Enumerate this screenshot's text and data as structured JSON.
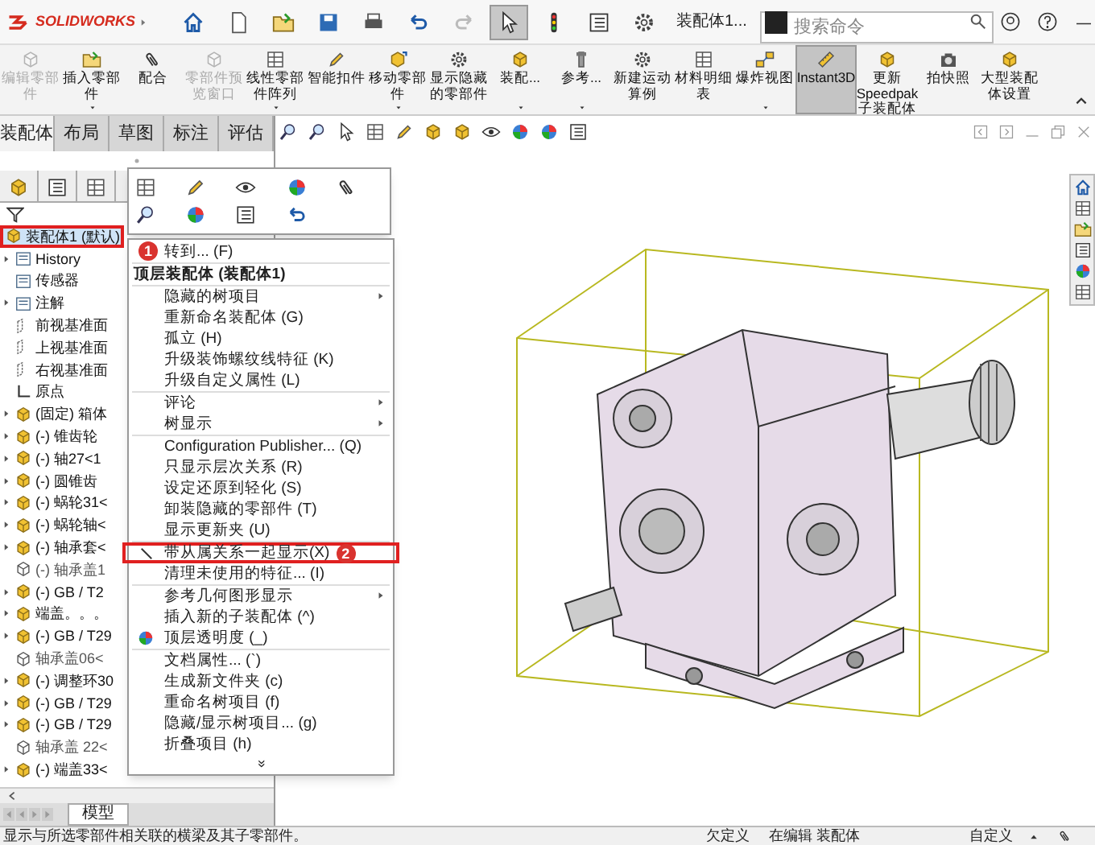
{
  "app": {
    "logo": "SOLIDWORKS",
    "title": "装配体1...",
    "search": {
      "placeholder": "搜索命令"
    }
  },
  "quick_tools": [
    {
      "selected": false
    },
    {
      "selected": false
    },
    {
      "selected": false
    },
    {
      "selected": false
    },
    {
      "selected": false
    },
    {
      "selected": false
    },
    {
      "selected": false
    },
    {
      "selected": true
    },
    {
      "selected": false
    },
    {
      "selected": false
    },
    {
      "selected": false
    }
  ],
  "ribbon": [
    {
      "label": "编辑零部件",
      "disabled": true,
      "dropdown": false,
      "selected": false
    },
    {
      "label": "插入零部件",
      "disabled": false,
      "dropdown": true,
      "selected": false
    },
    {
      "label": "配合",
      "disabled": false,
      "dropdown": false,
      "selected": false
    },
    {
      "label": "零部件预览窗口",
      "disabled": true,
      "dropdown": false,
      "selected": false
    },
    {
      "label": "线性零部件阵列",
      "disabled": false,
      "dropdown": true,
      "selected": false
    },
    {
      "label": "智能扣件",
      "disabled": false,
      "dropdown": false,
      "selected": false
    },
    {
      "label": "移动零部件",
      "disabled": false,
      "dropdown": true,
      "selected": false
    },
    {
      "label": "显示隐藏的零部件",
      "disabled": false,
      "dropdown": false,
      "selected": false
    },
    {
      "label": "装配...",
      "disabled": false,
      "dropdown": true,
      "selected": false
    },
    {
      "label": "参考...",
      "disabled": false,
      "dropdown": true,
      "selected": false
    },
    {
      "label": "新建运动算例",
      "disabled": false,
      "dropdown": false,
      "selected": false
    },
    {
      "label": "材料明细表",
      "disabled": false,
      "dropdown": false,
      "selected": false
    },
    {
      "label": "爆炸视图",
      "disabled": false,
      "dropdown": true,
      "selected": false
    },
    {
      "label": "Instant3D",
      "disabled": false,
      "dropdown": false,
      "selected": true
    },
    {
      "label": "更新 Speedpak 子装配体",
      "disabled": false,
      "dropdown": false,
      "selected": false
    },
    {
      "label": "拍快照",
      "disabled": false,
      "dropdown": false,
      "selected": false
    },
    {
      "label": "大型装配体设置",
      "disabled": false,
      "dropdown": false,
      "selected": false
    }
  ],
  "ribbon_tabs": [
    {
      "label": "装配体",
      "selected": true
    },
    {
      "label": "布局",
      "selected": false
    },
    {
      "label": "草图",
      "selected": false
    },
    {
      "label": "标注",
      "selected": false
    },
    {
      "label": "评估",
      "selected": false
    }
  ],
  "tree": [
    {
      "kind": "assembly",
      "label": "装配体1 (默认)",
      "expandable": false,
      "selected": true,
      "hidden": false
    },
    {
      "kind": "history",
      "label": "History",
      "expandable": true,
      "selected": false,
      "hidden": false
    },
    {
      "kind": "sensor",
      "label": "传感器",
      "expandable": false,
      "selected": false,
      "hidden": false
    },
    {
      "kind": "annotation",
      "label": "注解",
      "expandable": true,
      "selected": false,
      "hidden": false
    },
    {
      "kind": "plane",
      "label": "前视基准面",
      "expandable": false,
      "selected": false,
      "hidden": false
    },
    {
      "kind": "plane",
      "label": "上视基准面",
      "expandable": false,
      "selected": false,
      "hidden": false
    },
    {
      "kind": "plane",
      "label": "右视基准面",
      "expandable": false,
      "selected": false,
      "hidden": false
    },
    {
      "kind": "origin",
      "label": "原点",
      "expandable": false,
      "selected": false,
      "hidden": false
    },
    {
      "kind": "part",
      "label": "(固定) 箱体",
      "expandable": true,
      "selected": false,
      "hidden": false
    },
    {
      "kind": "part",
      "label": "(-) 锥齿轮",
      "expandable": true,
      "selected": false,
      "hidden": false
    },
    {
      "kind": "part",
      "label": "(-) 轴27<1",
      "expandable": true,
      "selected": false,
      "hidden": false
    },
    {
      "kind": "part",
      "label": "(-) 圆锥齿",
      "expandable": true,
      "selected": false,
      "hidden": false
    },
    {
      "kind": "part",
      "label": "(-) 蜗轮31<",
      "expandable": true,
      "selected": false,
      "hidden": false
    },
    {
      "kind": "part",
      "label": "(-) 蜗轮轴<",
      "expandable": true,
      "selected": false,
      "hidden": false
    },
    {
      "kind": "part",
      "label": "(-) 轴承套<",
      "expandable": true,
      "selected": false,
      "hidden": false
    },
    {
      "kind": "part",
      "label": "(-) 轴承盖1",
      "expandable": false,
      "selected": false,
      "hidden": true
    },
    {
      "kind": "part",
      "label": "(-) GB / T2",
      "expandable": true,
      "selected": false,
      "hidden": false
    },
    {
      "kind": "part",
      "label": "端盖。。。",
      "expandable": true,
      "selected": false,
      "hidden": false
    },
    {
      "kind": "part",
      "label": "(-) GB / T29",
      "expandable": true,
      "selected": false,
      "hidden": false
    },
    {
      "kind": "part",
      "label": "轴承盖06<",
      "expandable": false,
      "selected": false,
      "hidden": true
    },
    {
      "kind": "part",
      "label": "(-) 调整环30",
      "expandable": true,
      "selected": false,
      "hidden": false
    },
    {
      "kind": "part",
      "label": "(-) GB / T29",
      "expandable": true,
      "selected": false,
      "hidden": false
    },
    {
      "kind": "part",
      "label": "(-) GB / T29",
      "expandable": true,
      "selected": false,
      "hidden": false
    },
    {
      "kind": "part",
      "label": "轴承盖 22<",
      "expandable": false,
      "selected": false,
      "hidden": true
    },
    {
      "kind": "part",
      "label": "(-) 端盖33<",
      "expandable": true,
      "selected": false,
      "hidden": false
    }
  ],
  "context_menu": {
    "groups": [
      {
        "items": [
          {
            "kind": "item",
            "label": "转到... (F)",
            "submenu": false,
            "highlighted": false,
            "callout": "1"
          }
        ]
      },
      {
        "items": [
          {
            "kind": "header",
            "label": "顶层装配体 (装配体1)"
          }
        ]
      },
      {
        "items": [
          {
            "kind": "item",
            "label": "隐藏的树项目",
            "submenu": true,
            "highlighted": false
          },
          {
            "kind": "item",
            "label": "重新命名装配体 (G)",
            "submenu": false,
            "highlighted": false
          },
          {
            "kind": "item",
            "label": "孤立 (H)",
            "submenu": false,
            "highlighted": false
          },
          {
            "kind": "item",
            "label": "升级装饰螺纹线特征 (K)",
            "submenu": false,
            "highlighted": false
          },
          {
            "kind": "item",
            "label": "升级自定义属性 (L)",
            "submenu": false,
            "highlighted": false
          }
        ]
      },
      {
        "items": [
          {
            "kind": "item",
            "label": "评论",
            "submenu": true,
            "highlighted": false
          },
          {
            "kind": "item",
            "label": "树显示",
            "submenu": true,
            "highlighted": false
          }
        ]
      },
      {
        "items": [
          {
            "kind": "item",
            "label": "Configuration Publisher... (Q)",
            "submenu": false,
            "highlighted": false
          },
          {
            "kind": "item",
            "label": "只显示层次关系 (R)",
            "submenu": false,
            "highlighted": false
          },
          {
            "kind": "item",
            "label": "设定还原到轻化 (S)",
            "submenu": false,
            "highlighted": false
          },
          {
            "kind": "item",
            "label": "卸装隐藏的零部件 (T)",
            "submenu": false,
            "highlighted": false
          },
          {
            "kind": "item",
            "label": "显示更新夹 (U)",
            "submenu": false,
            "highlighted": false
          }
        ]
      },
      {
        "items": [
          {
            "kind": "item",
            "label": "带从属关系一起显示(X)",
            "submenu": false,
            "highlighted": true,
            "callout": "2"
          },
          {
            "kind": "item",
            "label": "清理未使用的特征... (I)",
            "submenu": false,
            "highlighted": false
          }
        ]
      },
      {
        "items": [
          {
            "kind": "item",
            "label": "参考几何图形显示",
            "submenu": true,
            "highlighted": false
          },
          {
            "kind": "item",
            "label": "插入新的子装配体 (^)",
            "submenu": false,
            "highlighted": false
          },
          {
            "kind": "item",
            "label": "顶层透明度 (_)",
            "submenu": false,
            "highlighted": false
          }
        ]
      },
      {
        "items": [
          {
            "kind": "item",
            "label": "文档属性... (`)",
            "submenu": false,
            "highlighted": false
          },
          {
            "kind": "item",
            "label": "生成新文件夹 (c)",
            "submenu": false,
            "highlighted": false
          },
          {
            "kind": "item",
            "label": "重命名树项目 (f)",
            "submenu": false,
            "highlighted": false
          },
          {
            "kind": "item",
            "label": "隐藏/显示树项目... (g)",
            "submenu": false,
            "highlighted": false
          },
          {
            "kind": "item",
            "label": "折叠项目 (h)",
            "submenu": false,
            "highlighted": false
          }
        ]
      }
    ],
    "more": "»"
  },
  "model_tab": {
    "label": "模型"
  },
  "status_bar": {
    "message": "显示与所选零部件相关联的横梁及其子零部件。",
    "fields": [
      "欠定义",
      "在编辑 装配体",
      "自定义"
    ]
  }
}
